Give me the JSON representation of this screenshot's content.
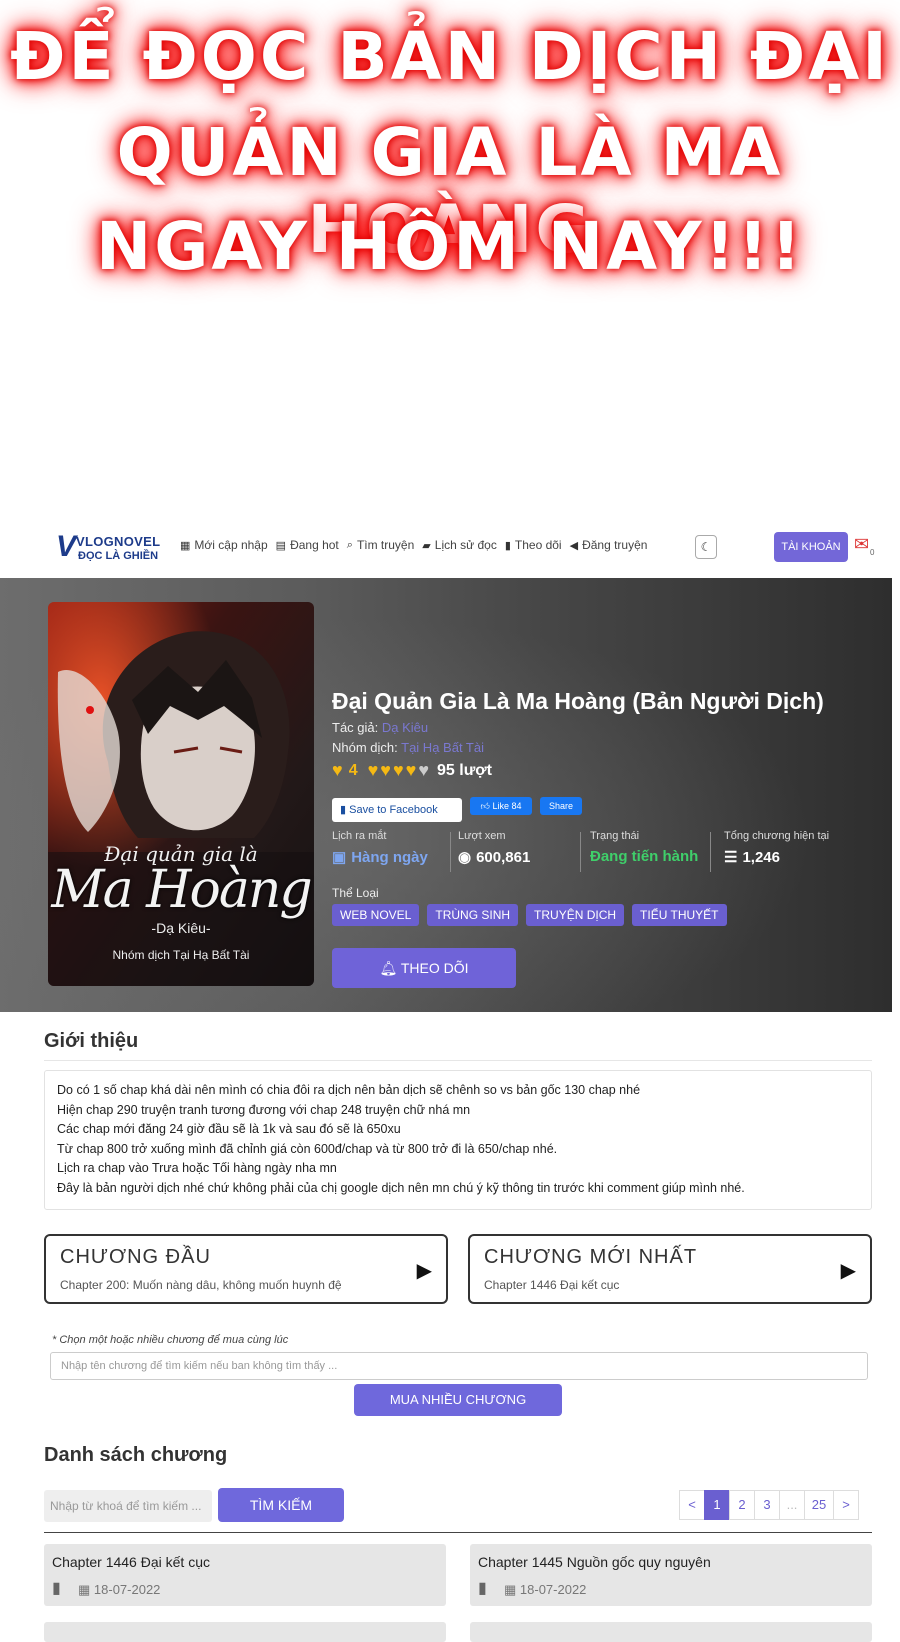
{
  "banner": {
    "line1": "ĐỂ ĐỌC BẢN DỊCH ĐẠI",
    "line2": "QUẢN GIA LÀ MA HOÀNG",
    "line3": "NGAY HÔM NAY!!!"
  },
  "navbar": {
    "logo_main": "VLOGNOVEL",
    "logo_sub": "ĐỌC LÀ GHIỀN",
    "items": [
      {
        "label": "Mới cập nhập",
        "icon": "grid-icon"
      },
      {
        "label": "Đang hot",
        "icon": "newspaper-icon"
      },
      {
        "label": "Tìm truyện",
        "icon": "search-icon"
      },
      {
        "label": "Lịch sử đọc",
        "icon": "book-icon"
      },
      {
        "label": "Theo dõi",
        "icon": "bookmark-icon"
      },
      {
        "label": "Đăng truyện",
        "icon": "megaphone-icon"
      }
    ],
    "account_label": "TÀI KHOẢN",
    "notif_count": "0"
  },
  "story": {
    "title": "Đại Quản Gia Là Ma Hoàng (Bản Người Dịch)",
    "author_label": "Tác giả:",
    "author_value": "Dạ Kiêu",
    "group_label": "Nhóm dịch:",
    "group_value": "Tại Hạ Bất Tài",
    "rating_value": "4",
    "rating_stars_filled": 4,
    "rating_stars_total": 5,
    "rating_count": "95 lượt",
    "fb_save": "Save to Facebook",
    "fb_like": "Like 84",
    "fb_share": "Share",
    "stats": [
      {
        "label": "Lịch ra mắt",
        "value": "Hàng ngày",
        "color": "#7ea6f0",
        "icon": "calendar-icon"
      },
      {
        "label": "Lượt xem",
        "value": "600,861",
        "color": "#ffffff",
        "icon": "eye-icon"
      },
      {
        "label": "Trạng thái",
        "value": "Đang tiến hành",
        "color": "#3fcf6a",
        "icon": ""
      },
      {
        "label": "Tổng chương hiện tại",
        "value": "1,246",
        "color": "#ffffff",
        "icon": "list-icon"
      }
    ],
    "genre_label": "Thể Loại",
    "genres": [
      "WEB NOVEL",
      "TRÙNG SINH",
      "TRUYỆN DỊCH",
      "TIỂU THUYẾT"
    ],
    "follow_label": "THEO DÕI",
    "cover": {
      "title_small": "Đại quản gia là",
      "title_big": "Ma Hoàng",
      "author": "-Dạ Kiêu-",
      "group": "Nhóm dịch Tại Hạ Bất Tài"
    }
  },
  "intro": {
    "heading": "Giới thiệu",
    "lines": [
      "Do có 1 số chap khá dài nên mình có chia đôi ra dịch nên bản dịch sẽ chênh so vs bản gốc 130 chap nhé",
      "Hiện chap 290 truyện tranh tương đương với chap 248 truyện chữ nhá mn",
      "Các chap mới đăng 24 giờ đầu sẽ là 1k và sau đó sẽ là 650xu",
      "Từ  chap 800 trở xuống mình đã chỉnh giá còn 600đ/chap và từ 800 trở đi là 650/chap nhé.",
      "Lịch ra chap vào Trưa hoặc Tối hàng ngày nha mn",
      "Đây là bản người dịch nhé chứ không phải của chị google dịch nên mn chú ý kỹ thông tin trước khi comment giúp mình nhé."
    ]
  },
  "first_chapter": {
    "heading": "CHƯƠNG ĐẦU",
    "name": "Chapter 200: Muốn nàng dâu, không muốn huynh đệ"
  },
  "latest_chapter": {
    "heading": "CHƯƠNG MỚI NHẤT",
    "name": "Chapter 1446 Đại kết cục"
  },
  "buy": {
    "note": "* Chọn một hoặc nhiều chương để mua cùng lúc",
    "placeholder": "Nhập tên chương để tìm kiếm nếu ban không tìm thấy ...",
    "button": "MUA NHIỀU CHƯƠNG"
  },
  "chapter_list": {
    "heading": "Danh sách chương",
    "search_placeholder": "Nhập từ khoá để tìm kiếm ...",
    "search_button": "TÌM KIẾM",
    "pager": [
      "<",
      "1",
      "2",
      "3",
      "...",
      "25",
      ">"
    ],
    "items": [
      {
        "name": "Chapter 1446 Đại kết cục",
        "date": "18-07-2022"
      },
      {
        "name": "Chapter 1445 Nguồn gốc quy nguyên",
        "date": "18-07-2022"
      }
    ]
  },
  "colors": {
    "accent": "#6f68dc",
    "genre": "#6a5fd0",
    "banner_glow": "#e00000"
  }
}
